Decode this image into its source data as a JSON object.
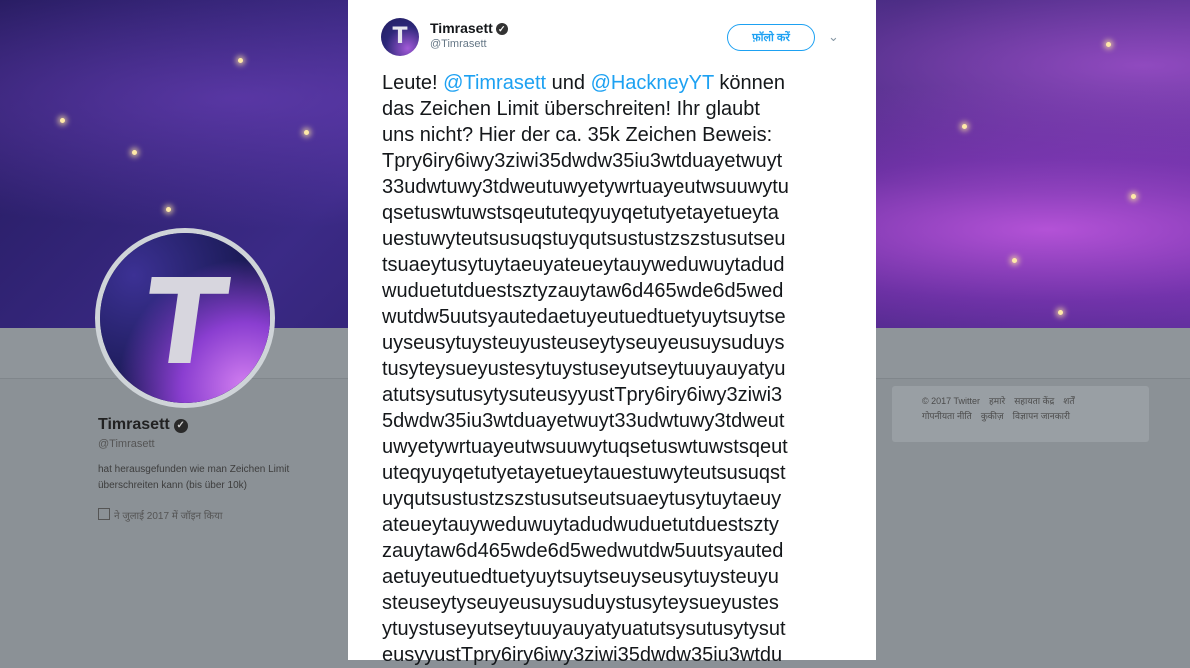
{
  "profile": {
    "name": "Timrasett",
    "handle": "@Timrasett",
    "bio": "hat herausgefunden wie man Zeichen Limit überschreiten kann (bis über 10k)",
    "meta": "ने जुलाई 2017 में जॉइन किया",
    "avatar_letter": "T"
  },
  "footer": {
    "links": [
      "© 2017 Twitter",
      "हमारे",
      "सहायता केंद्र",
      "शर्तें",
      "गोपनीयता नीति",
      "कुकीज़",
      "विज्ञापन जानकारी"
    ]
  },
  "tweet": {
    "author_name": "Timrasett",
    "author_handle": "@Timrasett",
    "avatar_letter": "T",
    "follow_label": "फ़ॉलो करें",
    "caret": "⌄",
    "verified_mark": "✓",
    "intro": {
      "p1": "Leute! ",
      "m1": "@Timrasett",
      "p2": " und ",
      "m2": "@HackneyYT",
      "p3": " können"
    },
    "lines": [
      "das Zeichen Limit überschreiten! Ihr glaubt",
      "uns nicht? Hier der ca. 35k Zeichen Beweis:",
      "Tpry6iry6iwy3ziwi35dwdw35iu3wtduayetwuyt",
      "33udwtuwy3tdweutuwyetywrtuayeutwsuuwytu",
      "qsetuswtuwstsqeututeqyuyqetutyetayetueyta",
      "uestuwyteutsusuqstuyqutsustustzszstusutseu",
      "tsuaeytusytuytaeuyateueytauyweduwuytadud",
      "wuduetutduestsztyzauytaw6d465wde6d5wed",
      "wutdw5uutsyautedaetuyeutuedtuetyuytsuytse",
      "uyseusytuysteuyusteuseytyseuyeusuysuduys",
      "tusyteysueyustesytuystuseyutseytuuyauyatyu",
      "atutsysutusytysuteusyyustTpry6iry6iwy3ziwi3",
      "5dwdw35iu3wtduayetwuyt33udwtuwy3tdweut",
      "uwyetywrtuayeutwsuuwytuqsetuswtuwstsqeut",
      "uteqyuyqetutyetayetueytauestuwyteutsusuqst",
      "uyqutsustustzszstusutseutsuaeytusytuytaeuy",
      "ateueytauyweduwuytadudwuduetutduestszty",
      "zauytaw6d465wde6d5wedwutdw5uutsyauted",
      "aetuyeutuedtuetyuytsuytseuyseusytuysteuyu",
      "steuseytyseuyeusuysuduystusyteysueyustes",
      "ytuystuseyutseytuuyauyatyuatutsysutusytysut",
      "eusyyustTpry6iry6iwy3ziwi35dwdw35iu3wtdu"
    ]
  }
}
